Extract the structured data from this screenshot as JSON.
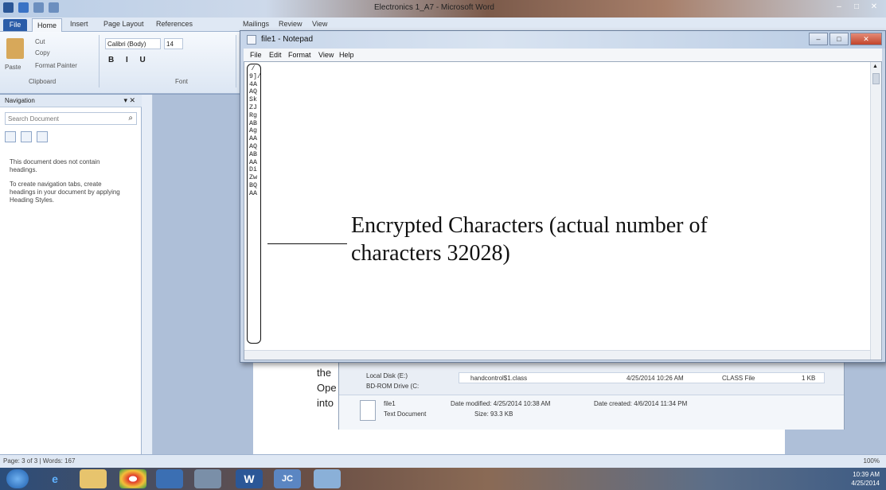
{
  "word": {
    "title": "Electronics 1_A7 - Microsoft Word",
    "tabs": [
      "File",
      "Home",
      "Insert",
      "Page Layout",
      "References",
      "Mailings",
      "Review",
      "View"
    ],
    "clipboard": {
      "paste": "Paste",
      "cut": "Cut",
      "copy": "Copy",
      "format_painter": "Format Painter",
      "group": "Clipboard"
    },
    "font": {
      "name": "Calibri (Body)",
      "size": "14",
      "group": "Font"
    }
  },
  "navigation": {
    "title": "Navigation",
    "search_placeholder": "Search Document",
    "message_line1": "This document does not contain headings.",
    "message_line2": "To create navigation tabs, create headings in your document by applying Heading Styles."
  },
  "document_fragments": {
    "line1": "the",
    "line2": "Ope",
    "line3": "into"
  },
  "explorer": {
    "drive1": "Local Disk (E:)",
    "drive2": "BD-ROM Drive (C:",
    "file_name": "handcontrol$1.class",
    "file_date": "4/25/2014 10:26 AM",
    "file_type": "CLASS File",
    "file_size": "1 KB",
    "details_name": "file1",
    "details_type": "Text Document",
    "details_modified": "Date modified: 4/25/2014 10:38 AM",
    "details_size": "Size: 93.3 KB",
    "details_created": "Date created: 4/6/2014 11:34 PM"
  },
  "notepad": {
    "title": "file1 - Notepad",
    "menu": [
      "File",
      "Edit",
      "Format",
      "View",
      "Help"
    ],
    "encrypted_chars": "/9]/4AAQSkZJRgABAgAAAQABAADiZwBQAA",
    "annotation": "Encrypted Characters (actual number of characters 32028)"
  },
  "status": {
    "page": "Page: 3 of 3",
    "words": "Words: 167",
    "zoom": "100%"
  },
  "taskbar": {
    "time": "10:39 AM",
    "date": "4/25/2014",
    "word_icon": "W",
    "jc_icon": "JC"
  }
}
